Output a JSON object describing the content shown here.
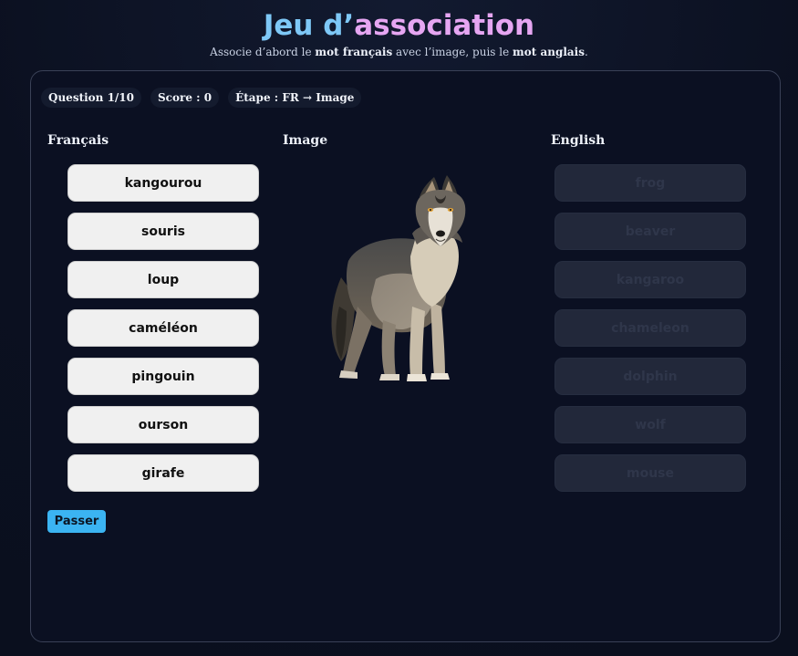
{
  "header": {
    "title_part1": "Jeu d’",
    "title_part2": "association",
    "subtitle_pre": "Associe d’abord le ",
    "subtitle_bold1": "mot français",
    "subtitle_mid": " avec l’image, puis le ",
    "subtitle_bold2": "mot anglais",
    "subtitle_post": "."
  },
  "stats": {
    "question": "Question 1/10",
    "score": "Score : 0",
    "step": "Étape : FR → Image"
  },
  "columns": {
    "french": "Français",
    "image": "Image",
    "english": "English"
  },
  "image": {
    "subject_icon": "wolf-image"
  },
  "french_words": [
    "kangourou",
    "souris",
    "loup",
    "caméléon",
    "pingouin",
    "ourson",
    "girafe"
  ],
  "english_words": [
    "frog",
    "beaver",
    "kangaroo",
    "chameleon",
    "dolphin",
    "wolf",
    "mouse"
  ],
  "actions": {
    "skip_label": "Passer"
  },
  "colors": {
    "accent_blue": "#3bb4f2",
    "title_blue": "#7ec8f7",
    "title_pink": "#e6a6f2"
  }
}
